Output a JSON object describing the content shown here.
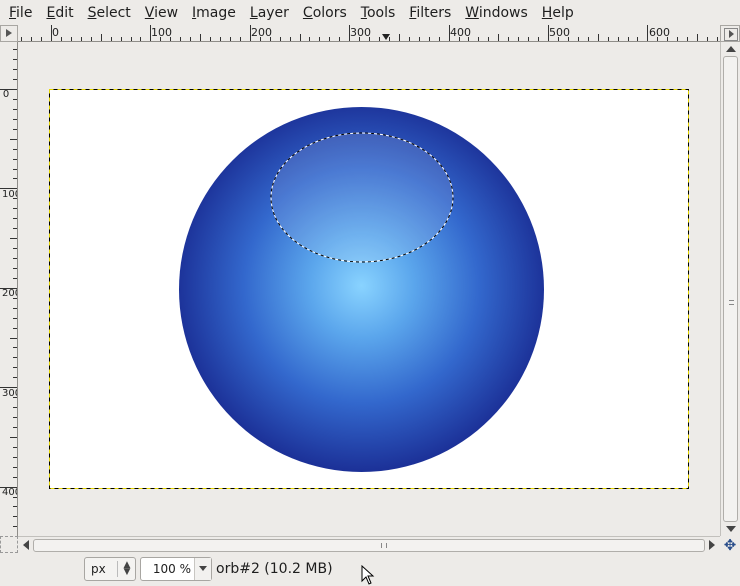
{
  "menubar": {
    "items": [
      "File",
      "Edit",
      "Select",
      "View",
      "Image",
      "Layer",
      "Colors",
      "Tools",
      "Filters",
      "Windows",
      "Help"
    ]
  },
  "rulers": {
    "horizontal_labels": [
      "0",
      "100",
      "200",
      "300",
      "400",
      "500",
      "600"
    ],
    "vertical_labels": [
      "0",
      "100",
      "200",
      "300",
      "400"
    ]
  },
  "statusbar": {
    "unit": "px",
    "zoom": "100 %",
    "image_info": "orb#2 (10.2 MB)"
  },
  "colors": {
    "orb_center": "#89d3ff",
    "orb_edge": "#07094e",
    "canvas_background": "#ffffff",
    "boundary": "#e8d800"
  },
  "icons": {
    "navigate": "move-arrows-icon",
    "quick_mask": "quick-mask-icon",
    "cursor": "pointer-cursor-icon"
  }
}
